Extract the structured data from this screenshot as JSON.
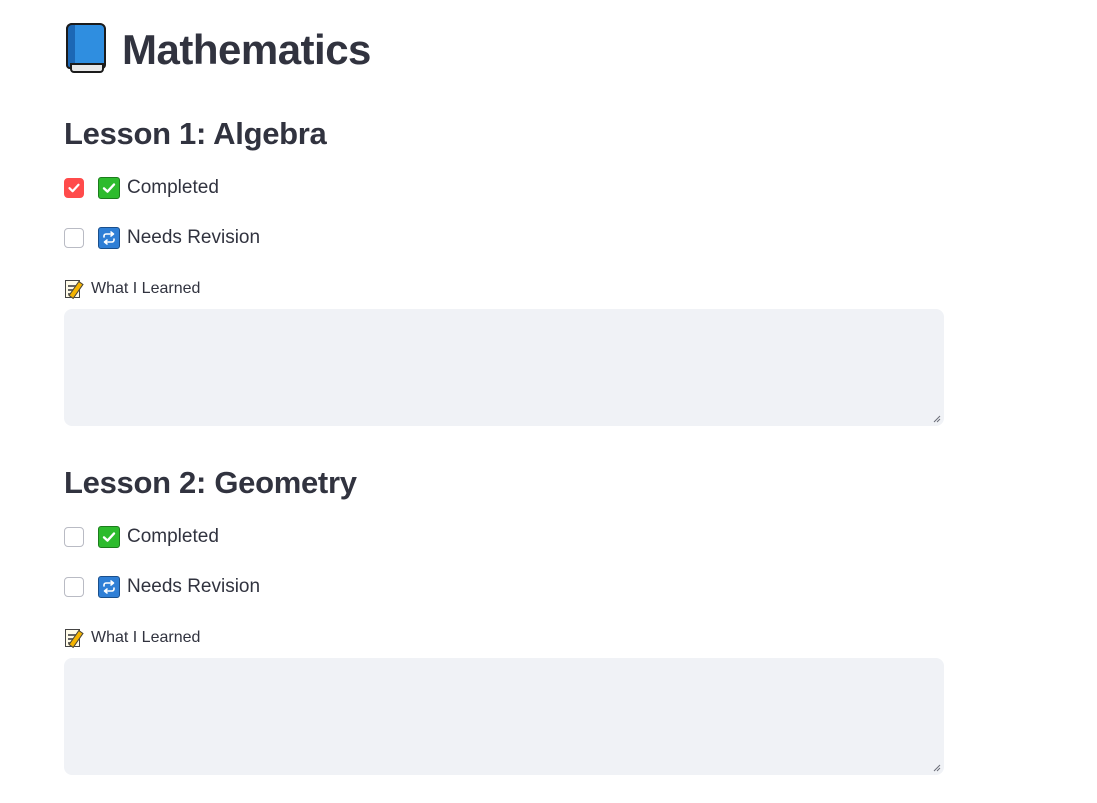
{
  "page": {
    "title": "Mathematics",
    "title_icon": "blue-book-icon"
  },
  "lessons": [
    {
      "heading": "Lesson 1: Algebra",
      "completed": {
        "label": "Completed",
        "checked": true,
        "icon": "check-mark-button-icon"
      },
      "needs_revision": {
        "label": "Needs Revision",
        "checked": false,
        "icon": "repeat-button-icon"
      },
      "notes": {
        "label": "What I Learned",
        "icon": "memo-icon",
        "value": ""
      }
    },
    {
      "heading": "Lesson 2: Geometry",
      "completed": {
        "label": "Completed",
        "checked": false,
        "icon": "check-mark-button-icon"
      },
      "needs_revision": {
        "label": "Needs Revision",
        "checked": false,
        "icon": "repeat-button-icon"
      },
      "notes": {
        "label": "What I Learned",
        "icon": "memo-icon",
        "value": ""
      }
    }
  ],
  "colors": {
    "accent": "#ff4b4b",
    "text": "#31333f",
    "input_background": "#f0f2f6"
  }
}
